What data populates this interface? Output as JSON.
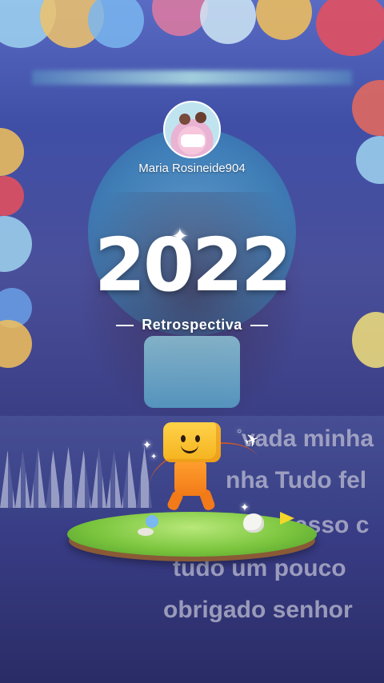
{
  "profile": {
    "username": "Maria Rosineide904",
    "avatar_icon": "profile-photo-avatar"
  },
  "hero": {
    "year": "2022",
    "subtitle": "Retrospectiva"
  },
  "background_caption": {
    "line1": "vada minha",
    "line2": "nha Tudo fel",
    "line3": "asso c",
    "line4": "tudo um pouco",
    "line5": "obrigado senhor"
  },
  "decor": {
    "mascot_icon": "box-head-mascot-icon",
    "plane_icon": "paper-plane-icon",
    "sparkle_icon": "sparkle-icon",
    "colors": {
      "grass": "#7cc63f",
      "mascot_head": "#ffd24a",
      "mascot_body": "#f27a18"
    }
  }
}
